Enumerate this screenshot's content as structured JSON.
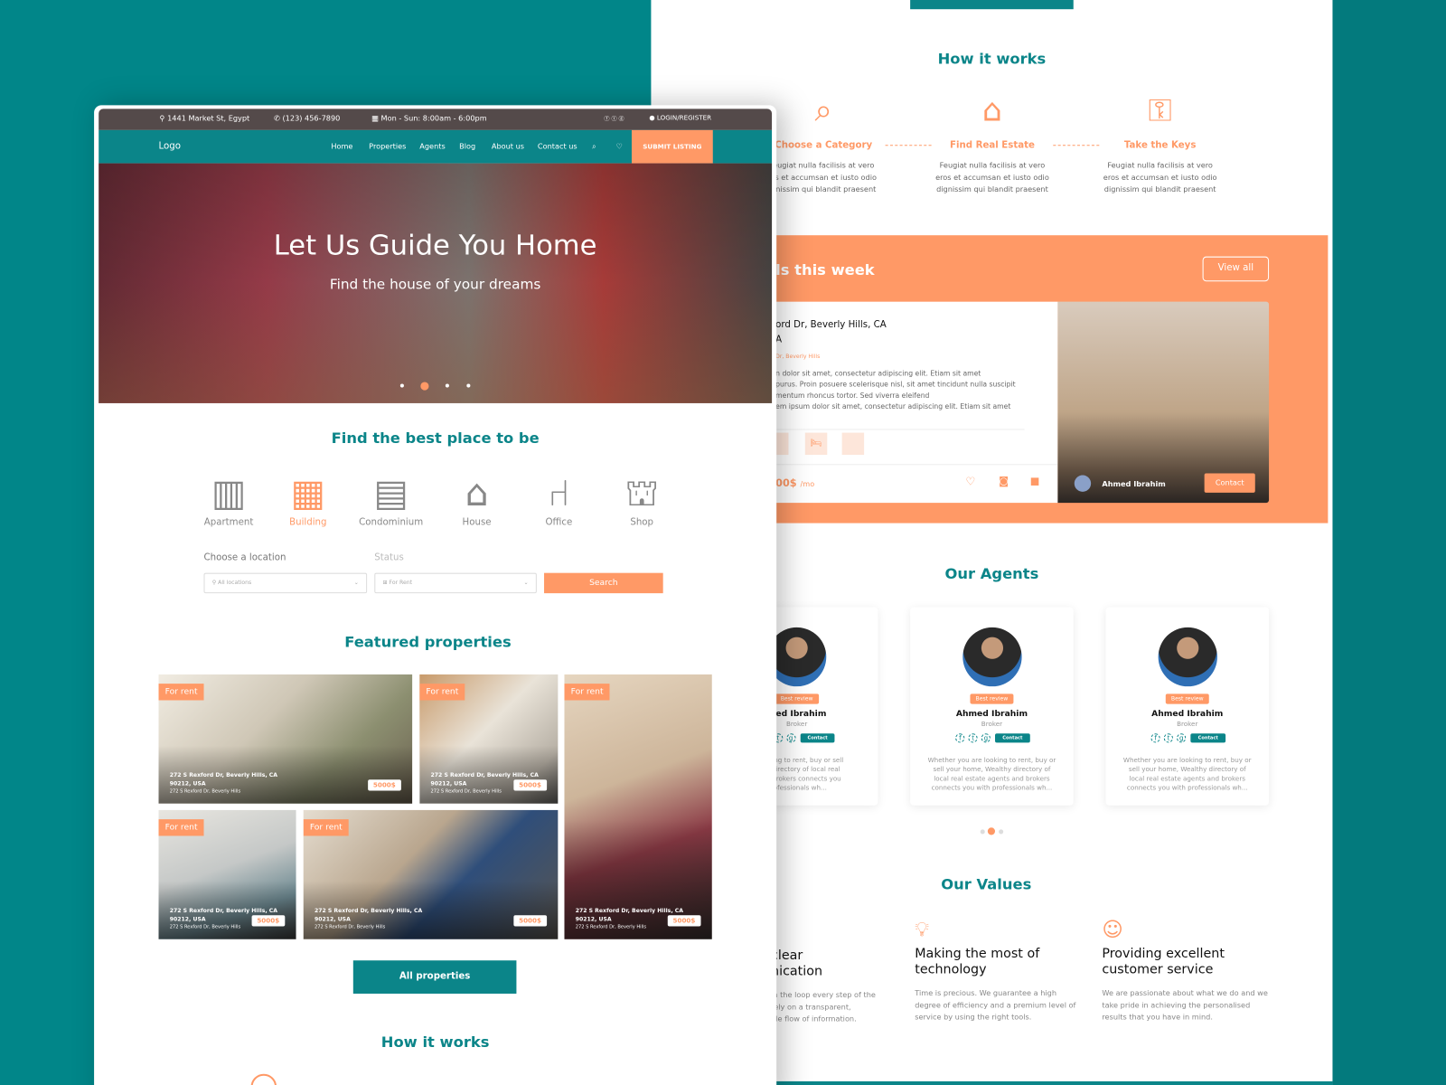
{
  "colors": {
    "teal": "#0b8589",
    "orange": "#ff9966",
    "background": "#018689",
    "topbar": "#544a4a"
  },
  "right_page": {
    "how_title": "How it works",
    "steps": [
      {
        "icon": "search-home-icon",
        "title": "Choose a Category",
        "desc": "eugiat nulla facilisis at vero\nos et accumsan et iusto odio\ngnissim qui blandit praesent"
      },
      {
        "icon": "hand-house-icon",
        "title": "Find Real Estate",
        "desc": "Feugiat nulla facilisis at vero\neros et accumsan et iusto odio\ndignissim qui blandit praesent"
      },
      {
        "icon": "key-hand-icon",
        "title": "Take the Keys",
        "desc": "Feugiat nulla facilisis at vero\neros et accumsan et iusto odio\ndignissim qui blandit praesent"
      }
    ],
    "deals": {
      "title": "ls this week",
      "view_all": "View all",
      "address": "ord Dr, Beverly Hills, CA\nA",
      "sub": "Dr, Beverly Hills",
      "desc": "n dolor sit amet, consectetur adipiscing elit. Etiam sit amet\npurus. Proin posuere scelerisque nisl, sit amet tincidunt nulla suscipit\nmentum rhoncus tortor. Sed viverra eleifend\nem ipsum dolor sit amet, consectetur adipiscing elit. Etiam sit amet",
      "price": "00$",
      "per": "/mo",
      "agent": "Ahmed Ibrahim",
      "contact": "Contact"
    },
    "agents_title": "Our Agents",
    "agents": [
      {
        "badge": "Best review",
        "name": "med Ibrahim",
        "role": "Broker",
        "contact": "Contact",
        "desc": "re looking to rent, buy or sell\nalthy directory of local real\ns and brokers connects you\nprofessionals wh..."
      },
      {
        "badge": "Best review",
        "name": "Ahmed Ibrahim",
        "role": "Broker",
        "contact": "Contact",
        "desc": "Whether you are looking to rent, buy or sell your home, Wealthy directory of local real estate agents and brokers connects you with professionals wh..."
      },
      {
        "badge": "Best review",
        "name": "Ahmed Ibrahim",
        "role": "Broker",
        "contact": "Contact",
        "desc": "Whether you are looking to rent, buy or sell your home, Wealthy directory of local real estate agents and brokers connects you with professionals wh..."
      }
    ],
    "values_title": "Our Values",
    "values": [
      {
        "title": "clear\nnication",
        "desc": "in the loop every step of the\nrely on a transparent,\nble flow of information."
      },
      {
        "icon": "lightbulb-icon",
        "title": "Making the most of technology",
        "desc": "Time is precious. We guarantee a high degree of efficiency and a premium level of service by using the right tools."
      },
      {
        "icon": "support-agent-icon",
        "title": "Providing excellent customer service",
        "desc": "We are passionate about what we do and we take pride in achieving the personalised results that you have in mind."
      }
    ]
  },
  "left_page": {
    "topbar": {
      "address": "1441 Market St, Egypt",
      "phone": "(123) 456-7890",
      "hours": "Mon - Sun: 8:00am - 6:00pm",
      "login": "LOGIN/REGISTER"
    },
    "nav": {
      "logo": "Logo",
      "links": [
        "Home",
        "Properties",
        "Agents",
        "Blog",
        "About us",
        "Contact us"
      ],
      "submit": "SUBMIT LISTING"
    },
    "hero": {
      "title": "Let Us Guide You Home",
      "subtitle": "Find the house of your dreams",
      "active_slide": 2,
      "slides": 4
    },
    "find_title": "Find the best place to be",
    "categories": [
      {
        "label": "Apartment",
        "icon": "apartment-icon"
      },
      {
        "label": "Building",
        "icon": "building-icon",
        "active": true
      },
      {
        "label": "Condominium",
        "icon": "condominium-icon"
      },
      {
        "label": "House",
        "icon": "house-icon"
      },
      {
        "label": "Office",
        "icon": "office-chair-icon"
      },
      {
        "label": "Shop",
        "icon": "shop-icon"
      }
    ],
    "search": {
      "location_label": "Choose a location",
      "location_value": "All locations",
      "status_label": "Status",
      "status_value": "For Rent",
      "button": "Search"
    },
    "featured_title": "Featured properties",
    "properties": [
      {
        "tag": "For rent",
        "address": "272 S Rexford Dr, Beverly Hills, CA 90212, USA",
        "sub": "272 S Rexford Dr, Beverly Hills",
        "price": "5000$"
      },
      {
        "tag": "For rent",
        "address": "272 S Rexford Dr, Beverly Hills, CA 90212, USA",
        "sub": "272 S Rexford Dr, Beverly Hills",
        "price": "5000$"
      },
      {
        "tag": "For rent",
        "address": "272 S Rexford Dr, Beverly Hills, CA 90212, USA",
        "sub": "272 S Rexford Dr, Beverly Hills",
        "price": "5000$"
      },
      {
        "tag": "For rent",
        "address": "272 S Rexford Dr, Beverly Hills, CA 90212, USA",
        "sub": "272 S Rexford Dr, Beverly Hills",
        "price": "5000$"
      },
      {
        "tag": "For rent",
        "address": "272 S Rexford Dr, Beverly Hills, CA 90212, USA",
        "sub": "272 S Rexford Dr, Beverly Hills",
        "price": "5000$"
      },
      {
        "tag": "For rent",
        "address": "272 S Rexford Dr, Beverly Hills, CA 90212, USA",
        "sub": "272 S Rexford Dr, Beverly Hills",
        "price": "5000$"
      }
    ],
    "all_properties": "All properties",
    "how_title": "How it works"
  }
}
